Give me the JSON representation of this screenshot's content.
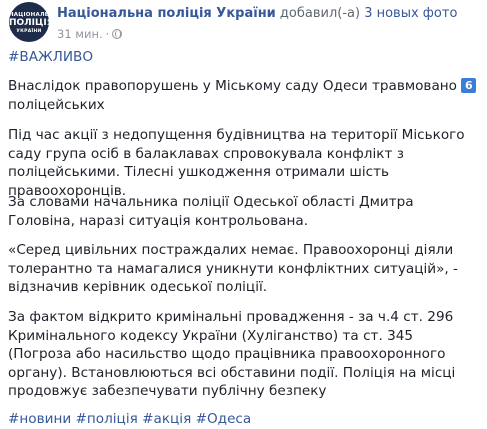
{
  "header": {
    "page_name": "Національна поліція України",
    "action": " добавил(-а) ",
    "new_photos": "3 новых фото",
    "timestamp": "31 мин.",
    "separator": "·",
    "audience_icon": "globe-icon",
    "avatar": {
      "line1": "НАЦІОНАЛЬНА",
      "line2": "ПОЛІЦІЯ",
      "line3": "УКРАЇНИ"
    }
  },
  "post": {
    "tag_top": "#ВАЖЛИВО",
    "headline_a": "Внаслідок правопорушень у Міському саду Одеси травмовано",
    "emoji_six": "6",
    "headline_b": "поліцейських",
    "p1": "Під час акції з недопущення будівництва на території Міського саду група осіб в балаклавах спровокувала конфлікт з поліцейськими. Тілесні ушкодження отримали шість правоохоронців.",
    "p2": "За словами начальника поліції Одеської області Дмитра Головіна, наразі ситуація контрольована.",
    "p3": "«Серед цивільних постраждалих немає. Правоохоронці діяли толерантно та намагалися уникнути конфліктних ситуацій», - відзначив керівник одеської поліції.",
    "p4": "За фактом відкрито кримінальні провадження - за ч.4 ст. 296 Кримінального кодексу України (Хуліганство) та ст. 345 (Погроза або насильство щодо працівника правоохоронного органу). Встановлюються всі обставини події. Поліція на місці продовжує забезпечувати публічну безпеку",
    "tags_bottom": [
      "#новини",
      "#поліція",
      "#акція",
      "#Одеса"
    ]
  },
  "colors": {
    "link": "#365899",
    "text": "#1d2129",
    "meta": "#90949c",
    "avatar_bg": "#1d2c48",
    "emoji_bg": "#3b7dd8"
  }
}
